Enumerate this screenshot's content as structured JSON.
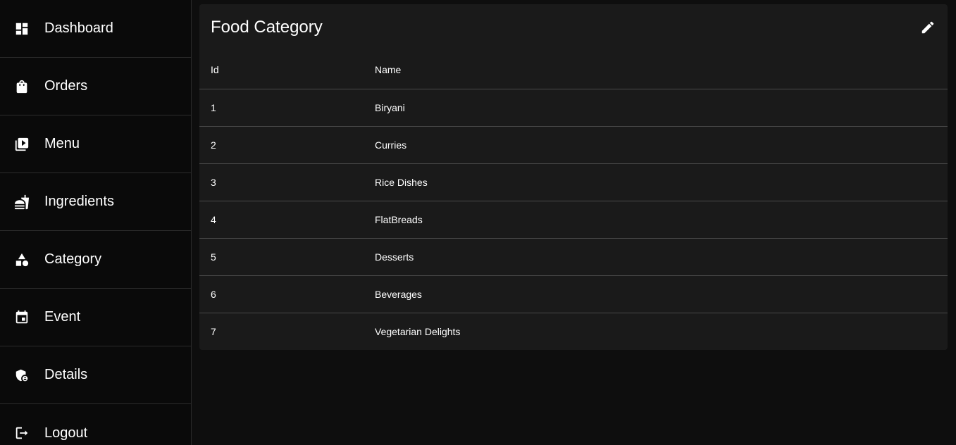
{
  "sidebar": {
    "items": [
      {
        "label": "Dashboard",
        "icon": "dashboard-icon"
      },
      {
        "label": "Orders",
        "icon": "shopping-bag-icon"
      },
      {
        "label": "Menu",
        "icon": "video-library-icon"
      },
      {
        "label": "Ingredients",
        "icon": "fastfood-icon"
      },
      {
        "label": "Category",
        "icon": "category-shapes-icon"
      },
      {
        "label": "Event",
        "icon": "event-calendar-icon"
      },
      {
        "label": "Details",
        "icon": "admin-shield-icon"
      },
      {
        "label": "Logout",
        "icon": "logout-icon"
      }
    ]
  },
  "card": {
    "title": "Food Category",
    "edit_icon": "edit-pencil-icon"
  },
  "table": {
    "columns": [
      "Id",
      "Name"
    ],
    "rows": [
      {
        "id": "1",
        "name": "Biryani"
      },
      {
        "id": "2",
        "name": "Curries"
      },
      {
        "id": "3",
        "name": "Rice Dishes"
      },
      {
        "id": "4",
        "name": "FlatBreads"
      },
      {
        "id": "5",
        "name": "Desserts"
      },
      {
        "id": "6",
        "name": "Beverages"
      },
      {
        "id": "7",
        "name": "Vegetarian Delights"
      }
    ]
  },
  "colors": {
    "page_background": "#0e0e0e",
    "sidebar_background": "#0a0a0a",
    "card_background": "#1a1a1a",
    "text": "#ffffff",
    "divider": "#4a4a4a"
  }
}
